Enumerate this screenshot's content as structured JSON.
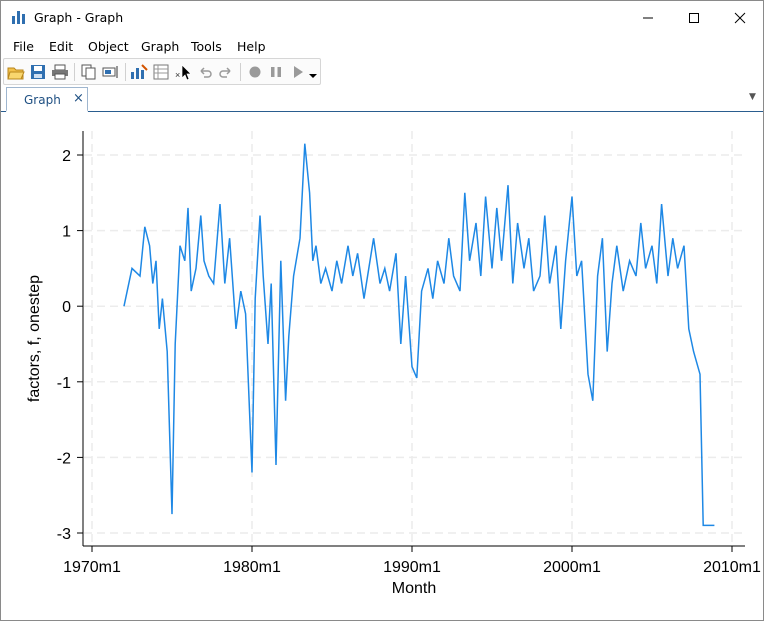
{
  "window": {
    "title": "Graph - Graph",
    "controls": [
      "minimize",
      "maximize",
      "close"
    ]
  },
  "menubar": {
    "items": [
      "File",
      "Edit",
      "Object",
      "Graph",
      "Tools",
      "Help"
    ]
  },
  "toolbar": {
    "icons": [
      "open-folder-icon",
      "save-icon",
      "print-icon",
      "copy-icon",
      "rename-icon",
      "graph-editor-icon",
      "data-browser-icon",
      "close-editor-icon",
      "undo-icon",
      "redo-icon",
      "record-icon",
      "pause-icon",
      "play-icon"
    ]
  },
  "tabs": {
    "items": [
      {
        "label": "Graph",
        "close": "×"
      }
    ]
  },
  "colors": {
    "line": "#1e88e5",
    "grid": "#ececec",
    "tab_accent": "#1e4f82"
  },
  "chart_data": {
    "type": "line",
    "title": "",
    "xlabel": "Month",
    "ylabel": "factors, f, onestep",
    "x_ticks": [
      "1970m1",
      "1980m1",
      "1990m1",
      "2000m1",
      "2010m1"
    ],
    "y_ticks": [
      "2",
      "1",
      "0",
      "-1",
      "-2",
      "-3"
    ],
    "xlim": [
      1970.0,
      2010.0
    ],
    "ylim": [
      -3.0,
      2.0
    ],
    "grid": true,
    "legend": "none",
    "series": [
      {
        "x": [
          1972.0,
          1972.5,
          1973.0,
          1973.3,
          1973.6,
          1973.8,
          1974.0,
          1974.2,
          1974.4,
          1974.7,
          1975.0,
          1975.2,
          1975.5,
          1975.8,
          1976.0,
          1976.2,
          1976.5,
          1976.8,
          1977.0,
          1977.3,
          1977.6,
          1978.0,
          1978.3,
          1978.6,
          1979.0,
          1979.3,
          1979.6,
          1980.0,
          1980.2,
          1980.5,
          1980.7,
          1981.0,
          1981.2,
          1981.5,
          1981.8,
          1982.1,
          1982.3,
          1982.6,
          1983.0,
          1983.3,
          1983.6,
          1983.8,
          1984.0,
          1984.3,
          1984.6,
          1985.0,
          1985.3,
          1985.6,
          1986.0,
          1986.3,
          1986.6,
          1987.0,
          1987.3,
          1987.6,
          1988.0,
          1988.3,
          1988.6,
          1989.0,
          1989.3,
          1989.6,
          1990.0,
          1990.3,
          1990.6,
          1991.0,
          1991.3,
          1991.6,
          1992.0,
          1992.3,
          1992.6,
          1993.0,
          1993.3,
          1993.6,
          1994.0,
          1994.3,
          1994.6,
          1995.0,
          1995.3,
          1995.6,
          1996.0,
          1996.3,
          1996.6,
          1997.0,
          1997.3,
          1997.6,
          1998.0,
          1998.3,
          1998.6,
          1999.0,
          1999.3,
          1999.6,
          2000.0,
          2000.3,
          2000.6,
          2001.0,
          2001.3,
          2001.6,
          2001.9,
          2002.2,
          2002.5,
          2002.8,
          2003.2,
          2003.6,
          2004.0,
          2004.3,
          2004.6,
          2005.0,
          2005.3,
          2005.6,
          2006.0,
          2006.3,
          2006.6,
          2007.0,
          2007.3,
          2007.6,
          2008.0,
          2008.2,
          2008.5,
          2008.7,
          2008.9
        ],
        "y": [
          0.0,
          0.5,
          0.4,
          1.05,
          0.8,
          0.3,
          0.6,
          -0.3,
          0.1,
          -0.6,
          -2.75,
          -0.5,
          0.8,
          0.6,
          1.3,
          0.2,
          0.5,
          1.2,
          0.6,
          0.4,
          0.3,
          1.35,
          0.3,
          0.9,
          -0.3,
          0.2,
          -0.1,
          -2.2,
          0.1,
          1.2,
          0.4,
          -0.5,
          0.3,
          -2.1,
          0.6,
          -1.25,
          -0.4,
          0.4,
          0.9,
          2.15,
          1.5,
          0.6,
          0.8,
          0.3,
          0.5,
          0.2,
          0.6,
          0.3,
          0.8,
          0.4,
          0.7,
          0.1,
          0.5,
          0.9,
          0.3,
          0.5,
          0.2,
          0.7,
          -0.5,
          0.4,
          -0.8,
          -0.95,
          0.2,
          0.5,
          0.1,
          0.6,
          0.3,
          0.9,
          0.4,
          0.2,
          1.5,
          0.6,
          1.1,
          0.4,
          1.45,
          0.5,
          1.3,
          0.6,
          1.6,
          0.3,
          1.1,
          0.5,
          0.9,
          0.2,
          0.4,
          1.2,
          0.3,
          0.8,
          -0.3,
          0.6,
          1.45,
          0.4,
          0.6,
          -0.9,
          -1.25,
          0.4,
          0.9,
          -0.6,
          0.3,
          0.8,
          0.2,
          0.6,
          0.4,
          1.1,
          0.5,
          0.8,
          0.3,
          1.35,
          0.4,
          0.9,
          0.5,
          0.8,
          -0.3,
          -0.6,
          -0.9,
          -2.9,
          -2.9,
          -2.9,
          -2.9
        ]
      }
    ]
  }
}
